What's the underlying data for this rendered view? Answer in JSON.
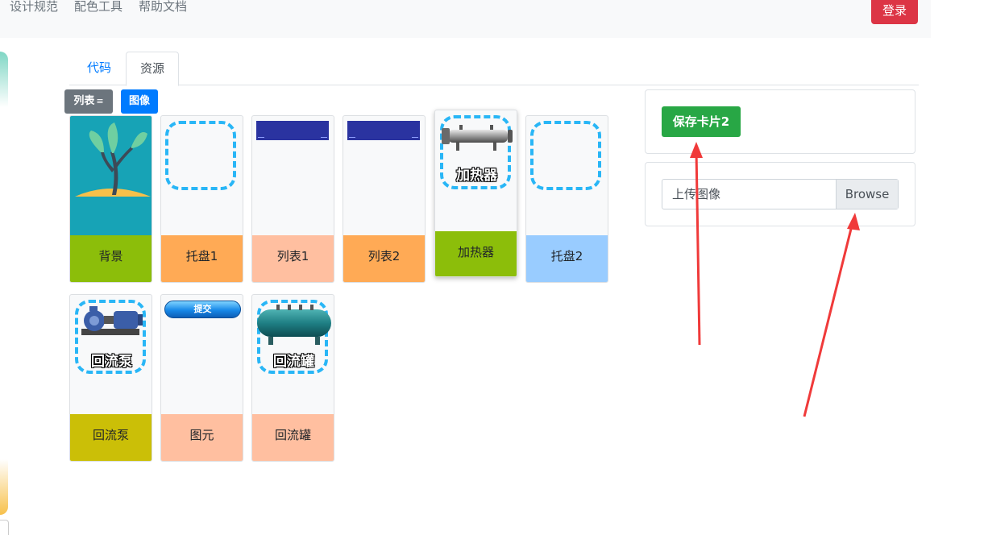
{
  "nav": {
    "links": [
      "设计规范",
      "配色工具",
      "帮助文档"
    ],
    "login_label": "登录"
  },
  "tabs": [
    {
      "label": "代码",
      "active": false
    },
    {
      "label": "资源",
      "active": true
    }
  ],
  "view_buttons": {
    "list_label": "列表",
    "list_icon": "≡",
    "image_label": "图像"
  },
  "cards": [
    {
      "label": "背景",
      "label_bg": "#8cbe0a"
    },
    {
      "label": "托盘1",
      "label_bg": "#ffaa55"
    },
    {
      "label": "列表1",
      "label_bg": "#ffbfa0"
    },
    {
      "label": "列表2",
      "label_bg": "#ffaa55"
    },
    {
      "label": "加热器",
      "label_bg": "#8cbe0a",
      "overlay_text": "加热器"
    },
    {
      "label": "托盘2",
      "label_bg": "#99ccff"
    },
    {
      "label": "回流泵",
      "label_bg": "#cbbf07",
      "overlay_text": "回流泵"
    },
    {
      "label": "图元",
      "label_bg": "#ffbfa0",
      "overlay_text": "提交"
    },
    {
      "label": "回流罐",
      "label_bg": "#ffbfa0",
      "overlay_text": "回流罐"
    }
  ],
  "save_button_label": "保存卡片2",
  "upload": {
    "placeholder": "上传图像",
    "browse_label": "Browse"
  },
  "colors": {
    "accent": "#007bff",
    "danger": "#dc3545",
    "success": "#28a745",
    "annotation": "#f03a3a"
  }
}
